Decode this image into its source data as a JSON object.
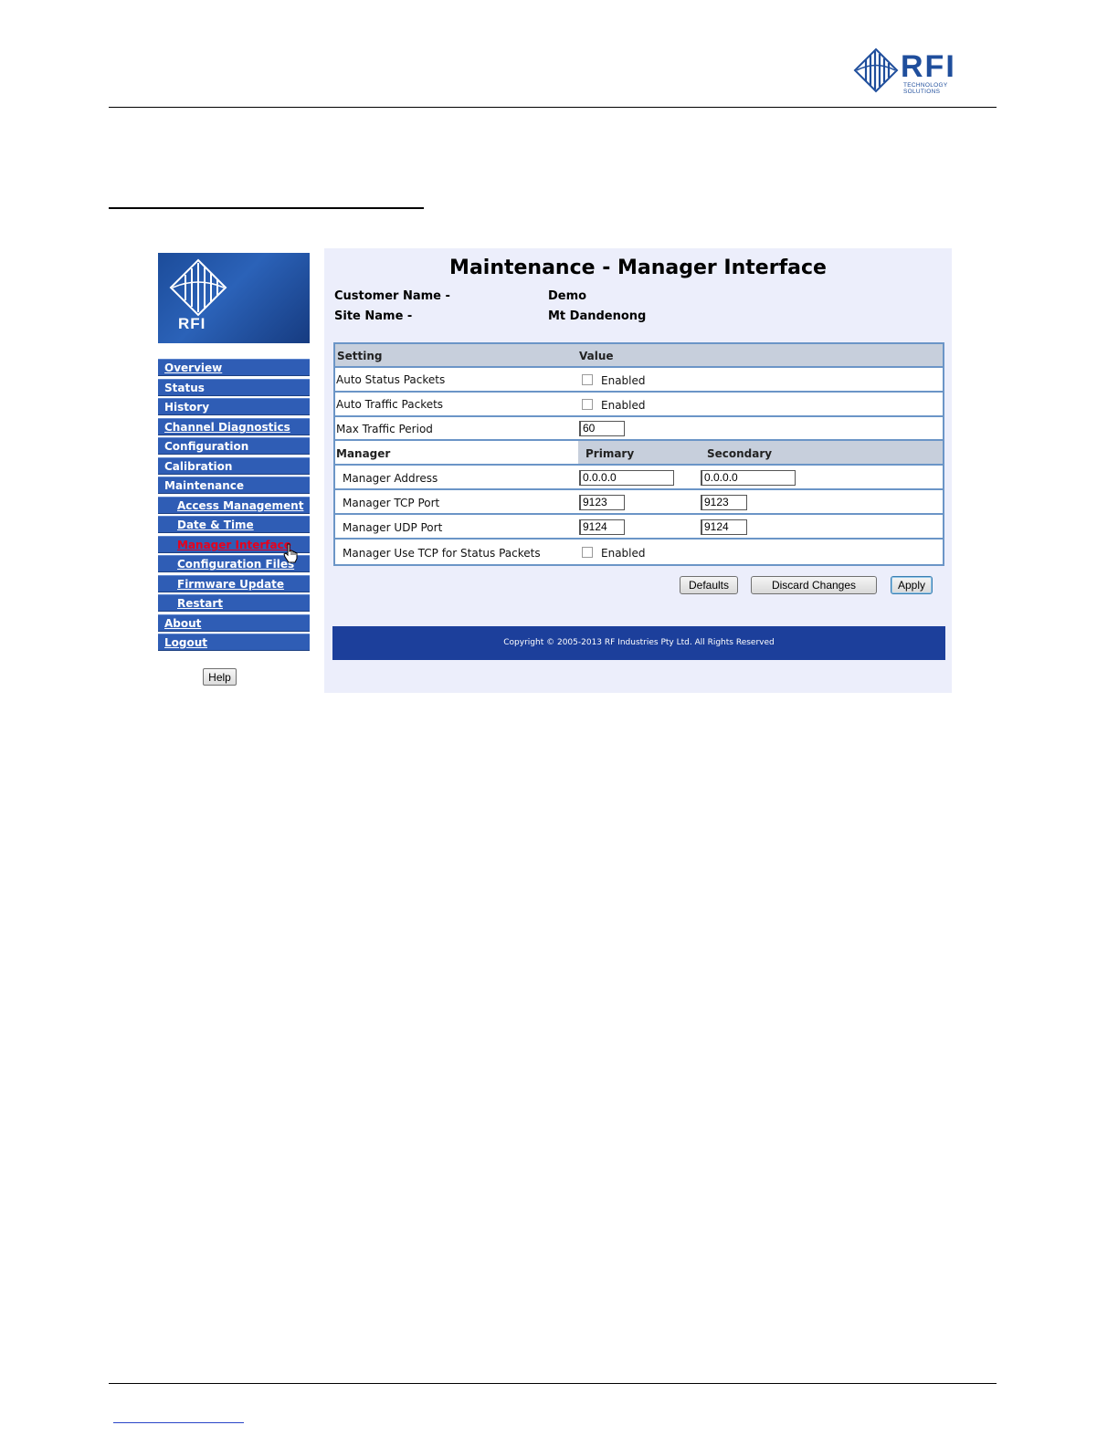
{
  "doc": {
    "logo_text": "RFI",
    "logo_subtext": "TECHNOLOGY SOLUTIONS"
  },
  "sidebar": {
    "logo_text": "RFI",
    "items": [
      {
        "label": "Overview"
      },
      {
        "label": "Status"
      },
      {
        "label": "History"
      },
      {
        "label": "Channel Diagnostics"
      },
      {
        "label": "Configuration"
      },
      {
        "label": "Calibration"
      },
      {
        "label": "Maintenance"
      },
      {
        "label": "Access Management"
      },
      {
        "label": "Date & Time"
      },
      {
        "label": "Manager Interface"
      },
      {
        "label": "Configuration Files"
      },
      {
        "label": "Firmware Update"
      },
      {
        "label": "Restart"
      },
      {
        "label": "About"
      },
      {
        "label": "Logout"
      }
    ],
    "help_label": "Help",
    "active_color": "#e8001c"
  },
  "main": {
    "title": "Maintenance - Manager Interface",
    "customer_label": "Customer Name -",
    "customer_value": "Demo",
    "site_label": "Site Name -",
    "site_value": "Mt Dandenong",
    "table": {
      "col_setting": "Setting",
      "col_value": "Value",
      "auto_status_label": "Auto Status Packets",
      "auto_status_enabled": "Enabled",
      "auto_status_checked": false,
      "auto_traffic_label": "Auto Traffic Packets",
      "auto_traffic_enabled": "Enabled",
      "auto_traffic_checked": false,
      "max_traffic_label": "Max Traffic Period",
      "max_traffic_value": "60",
      "manager_header": "Manager",
      "primary_header": "Primary",
      "secondary_header": "Secondary",
      "address_label": "Manager Address",
      "address_primary": "0.0.0.0",
      "address_secondary": "0.0.0.0",
      "tcp_label": "Manager TCP Port",
      "tcp_primary": "9123",
      "tcp_secondary": "9123",
      "udp_label": "Manager UDP Port",
      "udp_primary": "9124",
      "udp_secondary": "9124",
      "use_tcp_label": "Manager Use TCP for Status Packets",
      "use_tcp_enabled": "Enabled",
      "use_tcp_checked": false
    },
    "buttons": {
      "defaults": "Defaults",
      "discard": "Discard Changes",
      "apply": "Apply"
    },
    "copyright": "Copyright © 2005-2013 RF Industries Pty Ltd. All Rights Reserved"
  },
  "colors": {
    "nav_bg": "#2f5db5",
    "panel_bg": "#eceefb",
    "footer_bg": "#1c3f9b",
    "table_border": "#6b95c7"
  }
}
